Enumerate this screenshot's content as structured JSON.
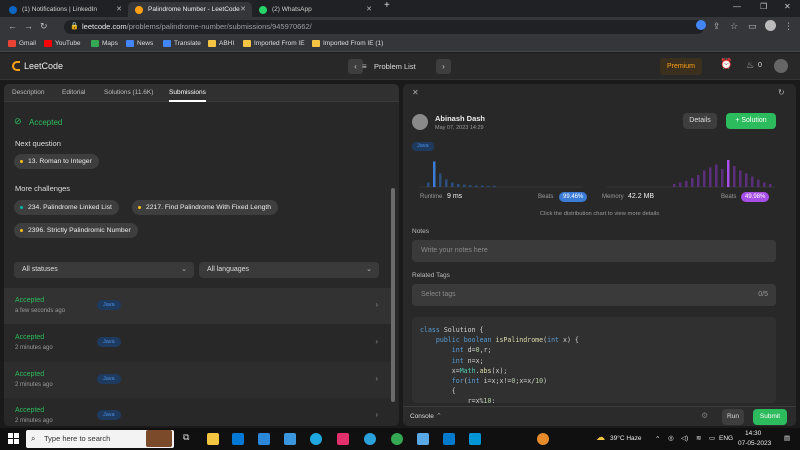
{
  "browser": {
    "tabs": [
      {
        "title": "(1) Notifications | LinkedIn",
        "favicon_color": "#0a66c2"
      },
      {
        "title": "Palindrome Number - LeetCode",
        "favicon_color": "#ffa116"
      },
      {
        "title": "(2) WhatsApp",
        "favicon_color": "#25d366"
      }
    ],
    "new_tab_label": "+",
    "url_domain": "leetcode.com",
    "url_path": "/problems/palindrome-number/submissions/945970662/",
    "bookmarks": [
      {
        "label": "Gmail",
        "color": "#ea4335"
      },
      {
        "label": "YouTube",
        "color": "#ff0000"
      },
      {
        "label": "Maps",
        "color": "#34a853"
      },
      {
        "label": "News",
        "color": "#4285f4"
      },
      {
        "label": "Translate",
        "color": "#4285f4"
      },
      {
        "label": "ABHI",
        "color": "#f4c542"
      },
      {
        "label": "Imported From IE",
        "color": "#f4c542"
      },
      {
        "label": "Imported From IE (1)",
        "color": "#f4c542"
      }
    ]
  },
  "lc_nav": {
    "logo": "LeetCode",
    "problem_list": "Problem List",
    "premium": "Premium",
    "streak": "0"
  },
  "left": {
    "tabs": [
      "Description",
      "Editorial",
      "Solutions (11.6K)",
      "Submissions"
    ],
    "accepted": "Accepted",
    "next_question_label": "Next question",
    "next_question": "13. Roman to Integer",
    "more_challenges_label": "More challenges",
    "challenges": [
      {
        "label": "234. Palindrome Linked List",
        "dot": "#00b8a3"
      },
      {
        "label": "2217. Find Palindrome With Fixed Length",
        "dot": "#ffc01e"
      },
      {
        "label": "2396. Strictly Palindromic Number",
        "dot": "#ffc01e"
      }
    ],
    "filter_status": "All statuses",
    "filter_language": "All languages",
    "submissions": [
      {
        "status": "Accepted",
        "time": "a few seconds ago",
        "lang": "Java"
      },
      {
        "status": "Accepted",
        "time": "2 minutes ago",
        "lang": "Java"
      },
      {
        "status": "Accepted",
        "time": "2 minutes ago",
        "lang": "Java"
      },
      {
        "status": "Accepted",
        "time": "2 minutes ago",
        "lang": "Java"
      }
    ]
  },
  "right": {
    "user_name": "Abinash Dash",
    "date": "May 07, 2023 14:29",
    "details_label": "Details",
    "solution_label": "+ Solution",
    "lang_badge": "Java",
    "runtime_label": "Runtime",
    "runtime_value": "9 ms",
    "runtime_beats_label": "Beats",
    "runtime_beats": "99.46%",
    "memory_label": "Memory",
    "memory_value": "42.2 MB",
    "memory_beats_label": "Beats",
    "memory_beats": "49.98%",
    "hint": "Click the distribution chart to view more details",
    "notes_label": "Notes",
    "notes_placeholder": "Write your notes here",
    "tags_label": "Related Tags",
    "tags_placeholder": "Select tags",
    "tags_count": "0/5",
    "code_lines": [
      "class Solution {",
      "    public boolean isPalindrome(int x) {",
      "        int d=0,r;",
      "        int n=x;",
      "        x=Math.abs(x);",
      "        for(int i=x;x!=0;x=x/10)",
      "        {",
      "            r=x%10;"
    ],
    "console_label": "Console",
    "run_label": "Run",
    "submit_label": "Submit",
    "runtime_hist": [
      0.15,
      0.85,
      0.45,
      0.25,
      0.15,
      0.1,
      0.08,
      0.06,
      0.05,
      0.05,
      0.04,
      0.04
    ],
    "memory_hist": [
      0.1,
      0.15,
      0.2,
      0.3,
      0.4,
      0.55,
      0.65,
      0.75,
      0.6,
      0.9,
      0.7,
      0.55,
      0.45,
      0.35,
      0.25,
      0.15,
      0.1
    ]
  },
  "taskbar": {
    "search_placeholder": "Type here to search",
    "weather": "39°C Haze",
    "lang": "ENG",
    "time": "14:30",
    "date": "07-05-2023"
  },
  "colors": {
    "accent": "#ffa116",
    "green": "#2cbb5d",
    "blue": "#3a7bd5",
    "purple": "#a84ee8"
  }
}
